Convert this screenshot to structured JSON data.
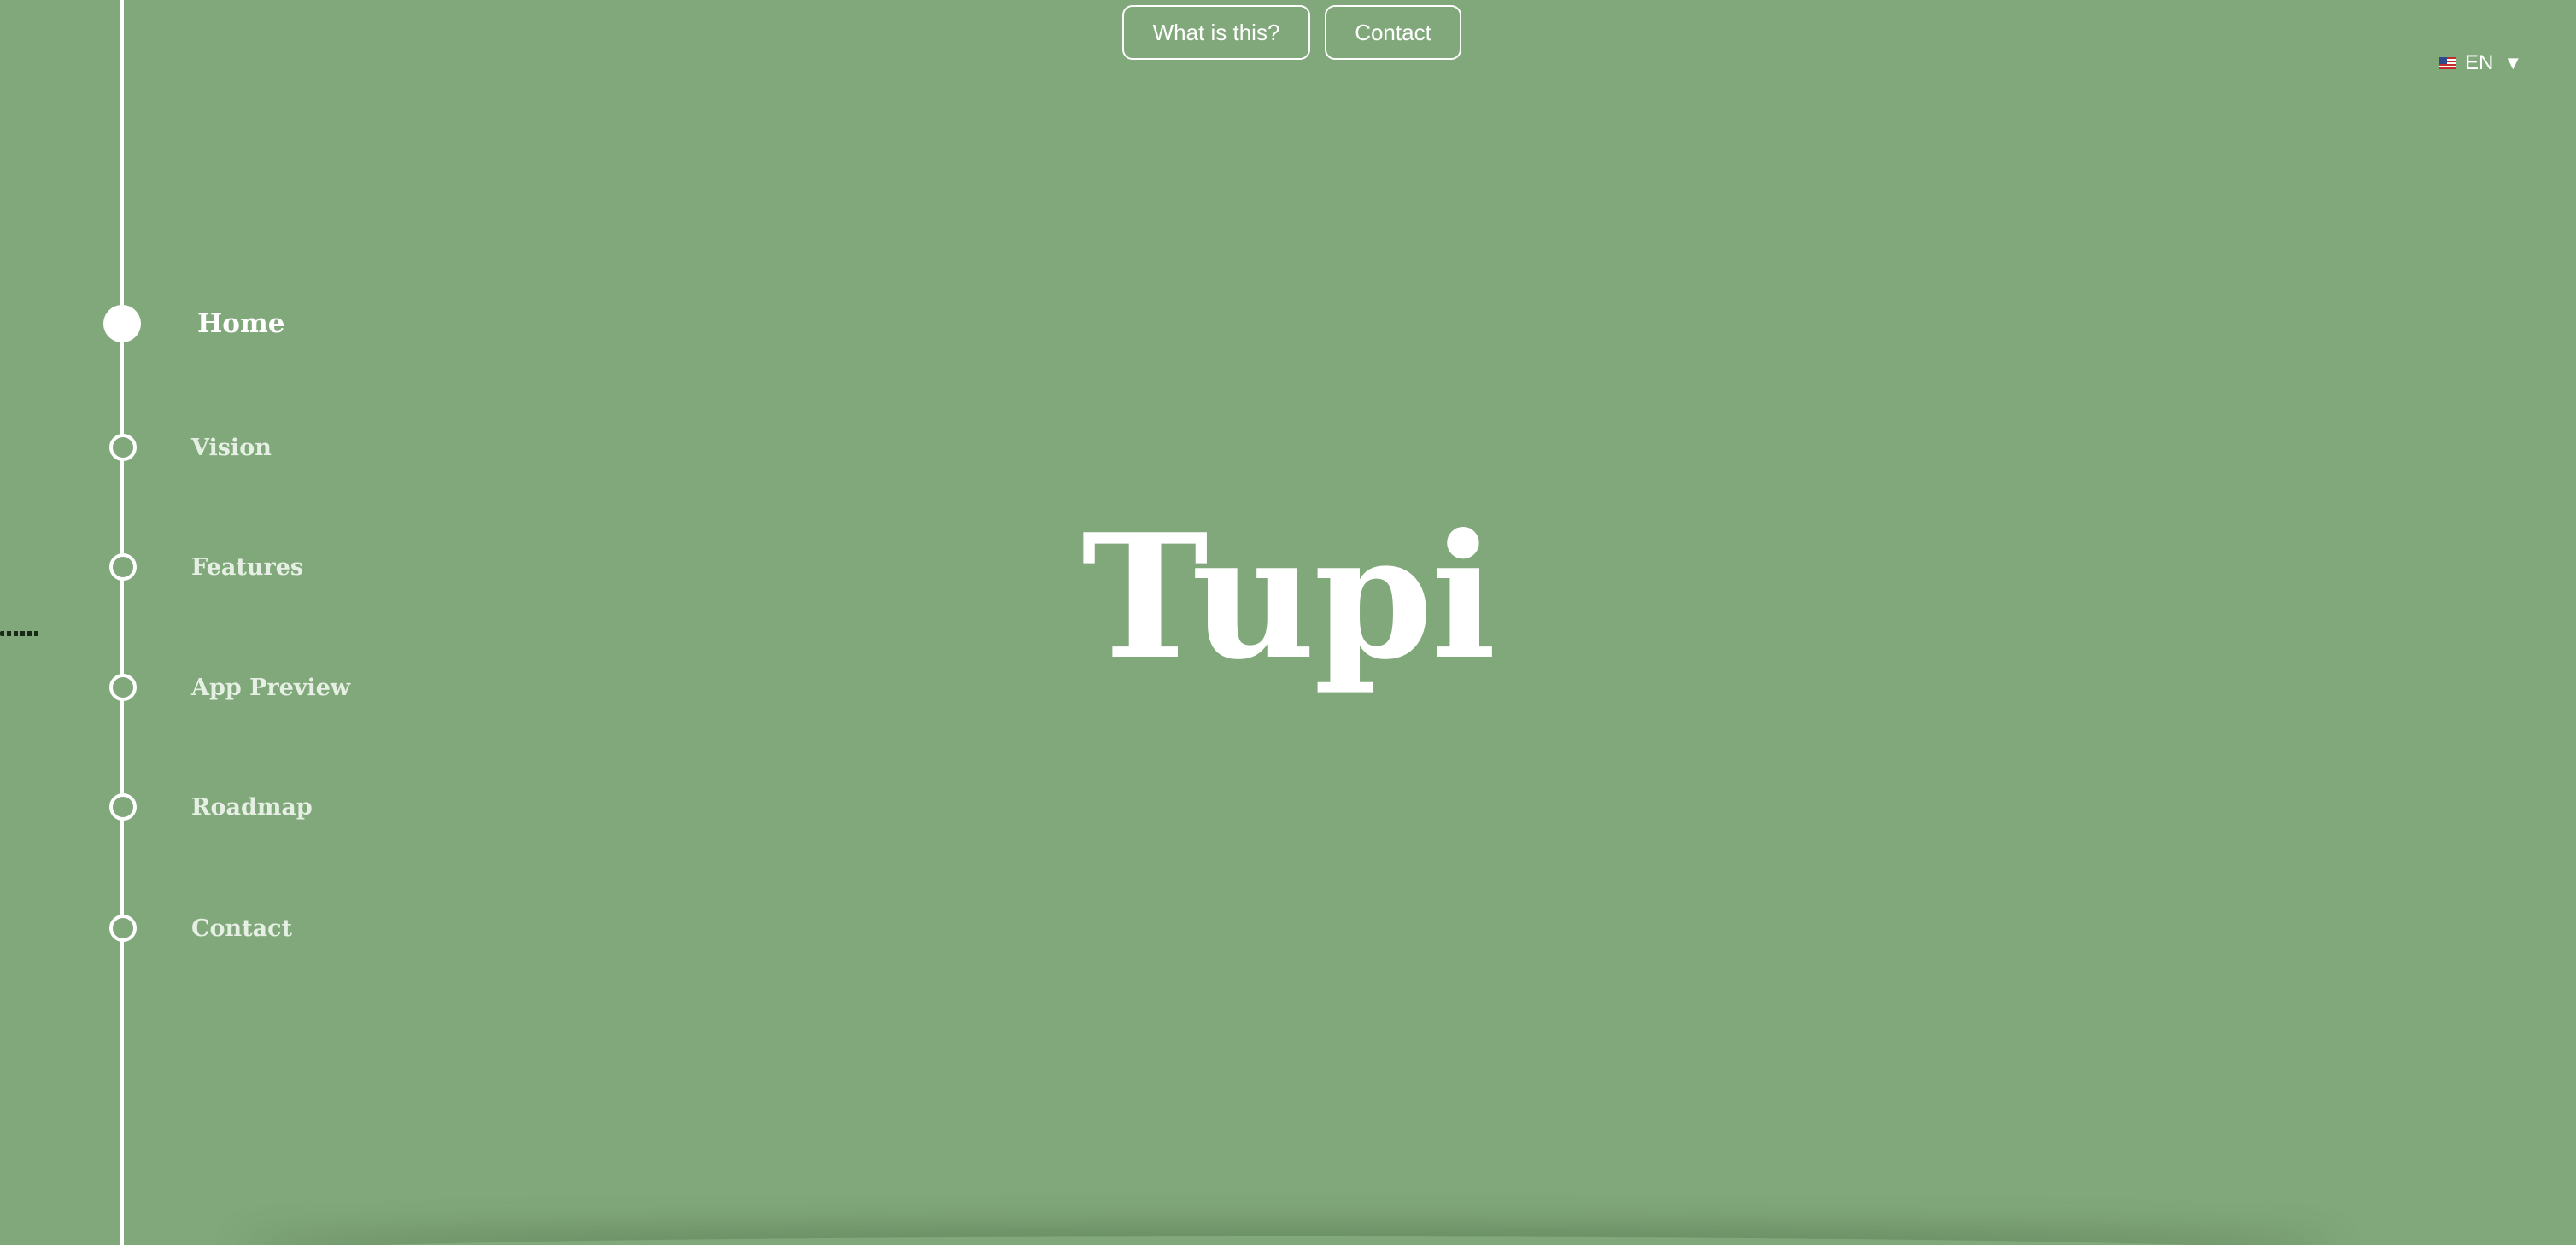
{
  "header": {
    "buttons": [
      {
        "label": "What is this?"
      },
      {
        "label": "Contact"
      }
    ],
    "language": {
      "flag_icon": "us-flag-icon",
      "label": "EN",
      "caret": "▼"
    }
  },
  "sidebar": {
    "items": [
      {
        "label": "Home",
        "active": true
      },
      {
        "label": "Vision"
      },
      {
        "label": "Features"
      },
      {
        "label": "App Preview"
      },
      {
        "label": "Roadmap"
      },
      {
        "label": "Contact"
      }
    ]
  },
  "hero": {
    "title": "Tupi"
  },
  "colors": {
    "background": "#81a87b",
    "foreground": "#ffffff"
  }
}
